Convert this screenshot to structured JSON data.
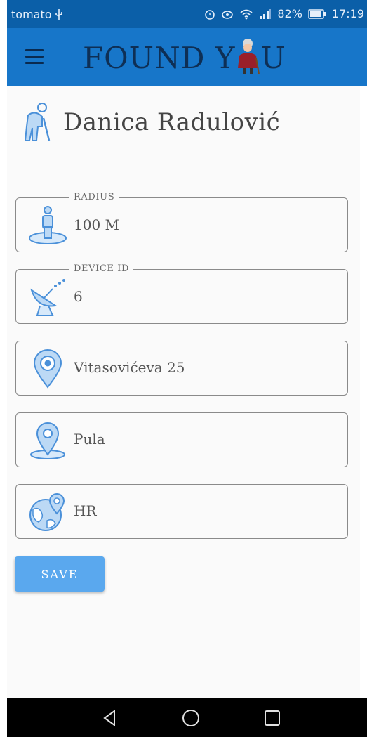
{
  "statusbar": {
    "carrier": "tomato",
    "battery": "82%",
    "time": "17:19"
  },
  "appbar": {
    "logo_text_left": "FOUND Y",
    "logo_text_right": "U",
    "icons": [
      "menu-icon",
      "grandma-icon"
    ]
  },
  "profile": {
    "name": "Danica Radulović",
    "icon": "elderly-person-icon"
  },
  "fields": {
    "radius": {
      "label": "RADIUS",
      "value": "100 M",
      "icon": "person-radius-icon"
    },
    "device": {
      "label": "DEVICE ID",
      "value": "6",
      "icon": "satellite-dish-icon"
    },
    "street": {
      "value": "Vitasovićeva 25",
      "icon": "location-pin-icon"
    },
    "city": {
      "value": "Pula",
      "icon": "map-marker-icon"
    },
    "country": {
      "value": "HR",
      "icon": "globe-pin-icon"
    }
  },
  "actions": {
    "save_label": "SAVE"
  },
  "colors": {
    "statusbar": "#0b5fa8",
    "appbar": "#1776c9",
    "accent": "#5aa8ee",
    "icon_blue": "#4a90d9"
  },
  "navbar": [
    "back-icon",
    "home-icon",
    "recents-icon"
  ]
}
